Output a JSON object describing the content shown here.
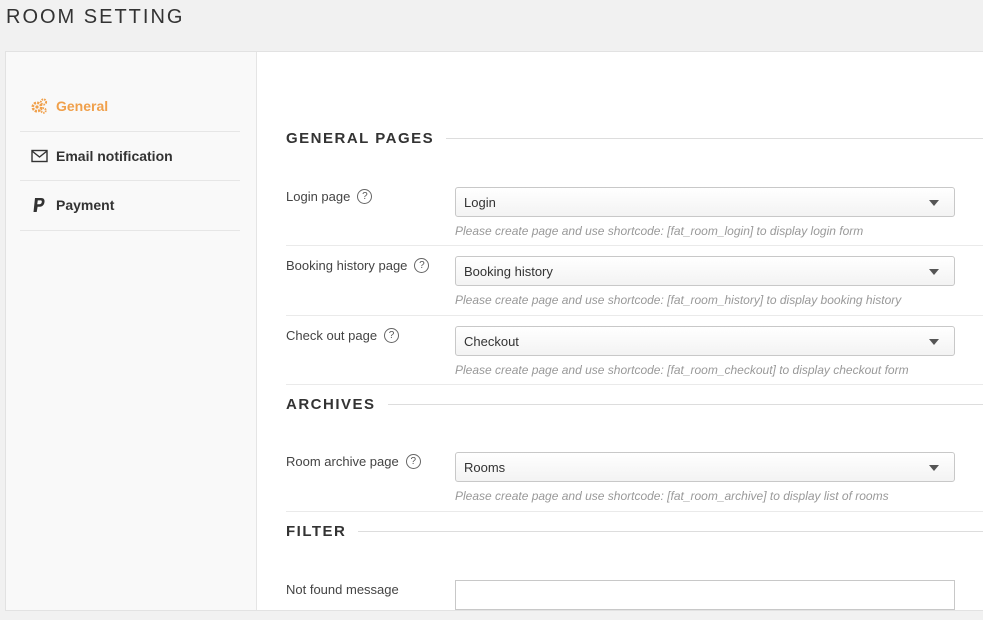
{
  "page": {
    "title": "ROOM SETTING"
  },
  "sidebar": {
    "items": [
      {
        "label": "General",
        "icon": "gears-icon",
        "active": true
      },
      {
        "label": "Email notification",
        "icon": "envelope-icon",
        "active": false
      },
      {
        "label": "Payment",
        "icon": "paypal-icon",
        "active": false
      }
    ]
  },
  "colors": {
    "accent": "#f0a04b"
  },
  "sections": {
    "general_pages": {
      "title": "GENERAL PAGES",
      "login": {
        "label": "Login page",
        "value": "Login",
        "hint": "Please create page and use shortcode: [fat_room_login] to display login form"
      },
      "booking_history": {
        "label": "Booking history page",
        "value": "Booking history",
        "hint": "Please create page and use shortcode: [fat_room_history] to display booking history"
      },
      "checkout": {
        "label": "Check out page",
        "value": "Checkout",
        "hint": "Please create page and use shortcode: [fat_room_checkout] to display checkout form"
      }
    },
    "archives": {
      "title": "ARCHIVES",
      "room_archive": {
        "label": "Room archive page",
        "value": "Rooms",
        "hint": "Please create page and use shortcode: [fat_room_archive] to display list of rooms"
      }
    },
    "filter": {
      "title": "FILTER",
      "not_found": {
        "label": "Not found message"
      }
    }
  }
}
